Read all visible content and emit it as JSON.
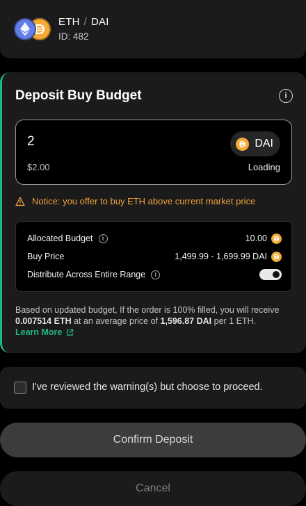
{
  "pair": {
    "base": "ETH",
    "separator": "/",
    "quote": "DAI",
    "id_label": "ID: 482"
  },
  "deposit": {
    "title": "Deposit Buy Budget",
    "amount_value": "2",
    "token_label": "DAI",
    "usd_value": "$2.00",
    "balance_status": "Loading",
    "notice": "Notice: you offer to buy ETH above current market price"
  },
  "details": {
    "allocated_label": "Allocated Budget",
    "allocated_value": "10.00",
    "buy_price_label": "Buy Price",
    "buy_price_value": "1,499.99 - 1,699.99 DAI",
    "distribute_label": "Distribute Across Entire Range",
    "distribute_on": true
  },
  "summary": {
    "part1": "Based on updated budget, If the order is 100% filled, you will receive ",
    "receive_amount": "0.007514 ETH",
    "part2": " at an average price of ",
    "avg_price": "1,596.87 DAI",
    "part3": " per 1 ETH.",
    "learn_more": "Learn More"
  },
  "acknowledge": {
    "label": "I've reviewed the warning(s) but choose to proceed.",
    "checked": false
  },
  "buttons": {
    "confirm": "Confirm Deposit",
    "cancel": "Cancel"
  },
  "colors": {
    "accent": "#1fb884",
    "warning": "#f0a23a",
    "eth": "#627eea",
    "dai": "#f5ac37"
  }
}
